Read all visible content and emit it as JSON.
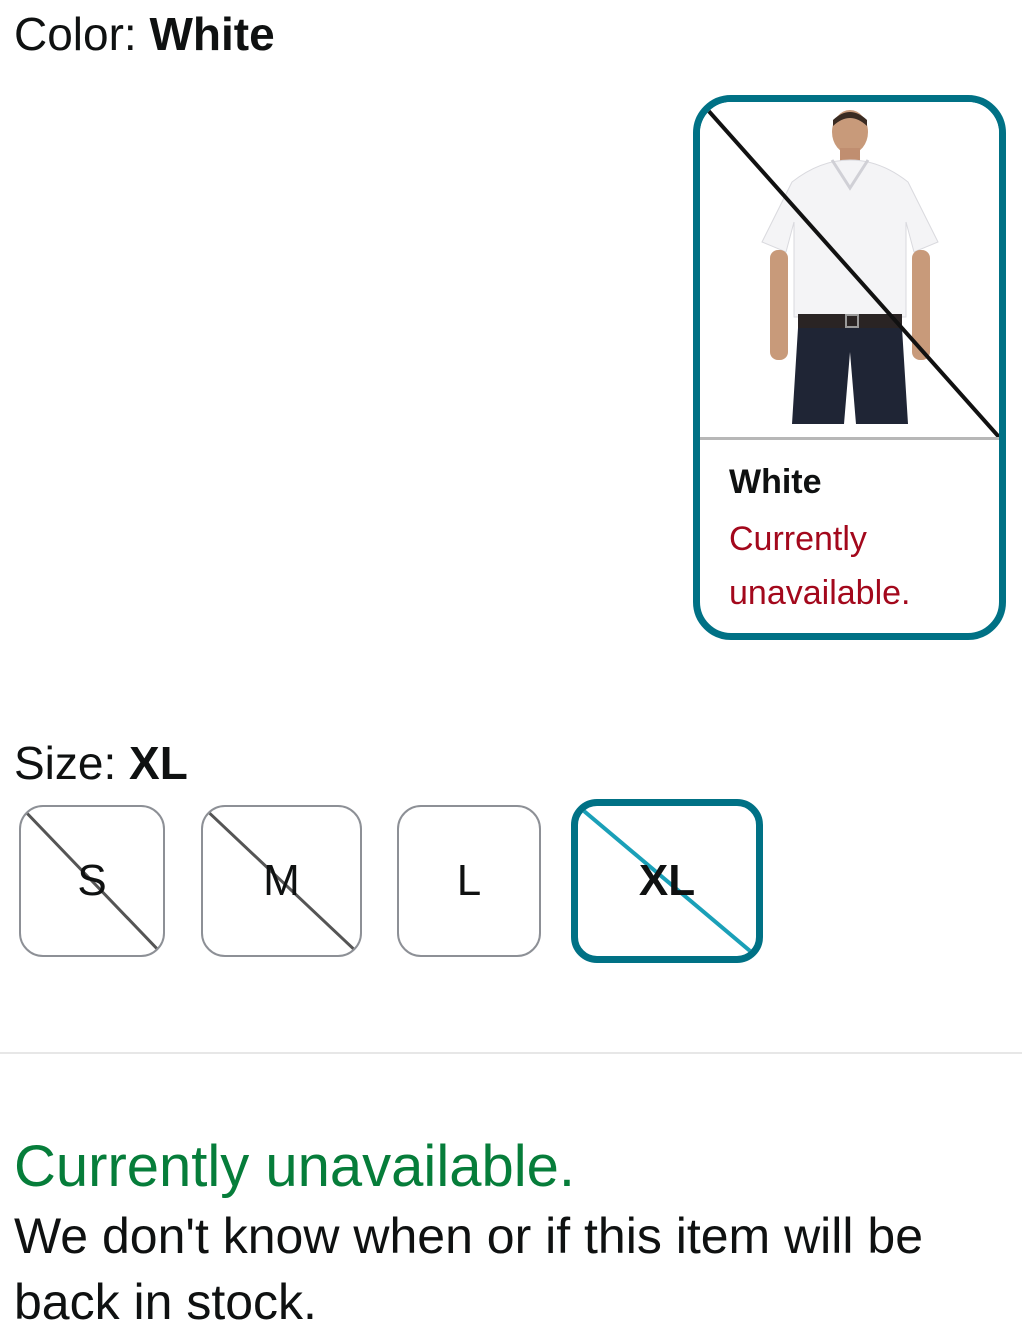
{
  "color": {
    "label": "Color: ",
    "value": "White"
  },
  "swatch": {
    "name": "White",
    "status": "Currently unavailable.",
    "image": "white-polo-shirt-model",
    "accent": "#007185",
    "unavailable": true
  },
  "size": {
    "label": "Size: ",
    "value": "XL",
    "options": [
      {
        "label": "S",
        "available": false,
        "selected": false
      },
      {
        "label": "M",
        "available": false,
        "selected": false
      },
      {
        "label": "L",
        "available": true,
        "selected": false
      },
      {
        "label": "XL",
        "available": false,
        "selected": true
      }
    ]
  },
  "availability": {
    "headline": "Currently unavailable.",
    "message": "We don't know when or if this item will be back in stock.",
    "color": "#067d3a"
  }
}
